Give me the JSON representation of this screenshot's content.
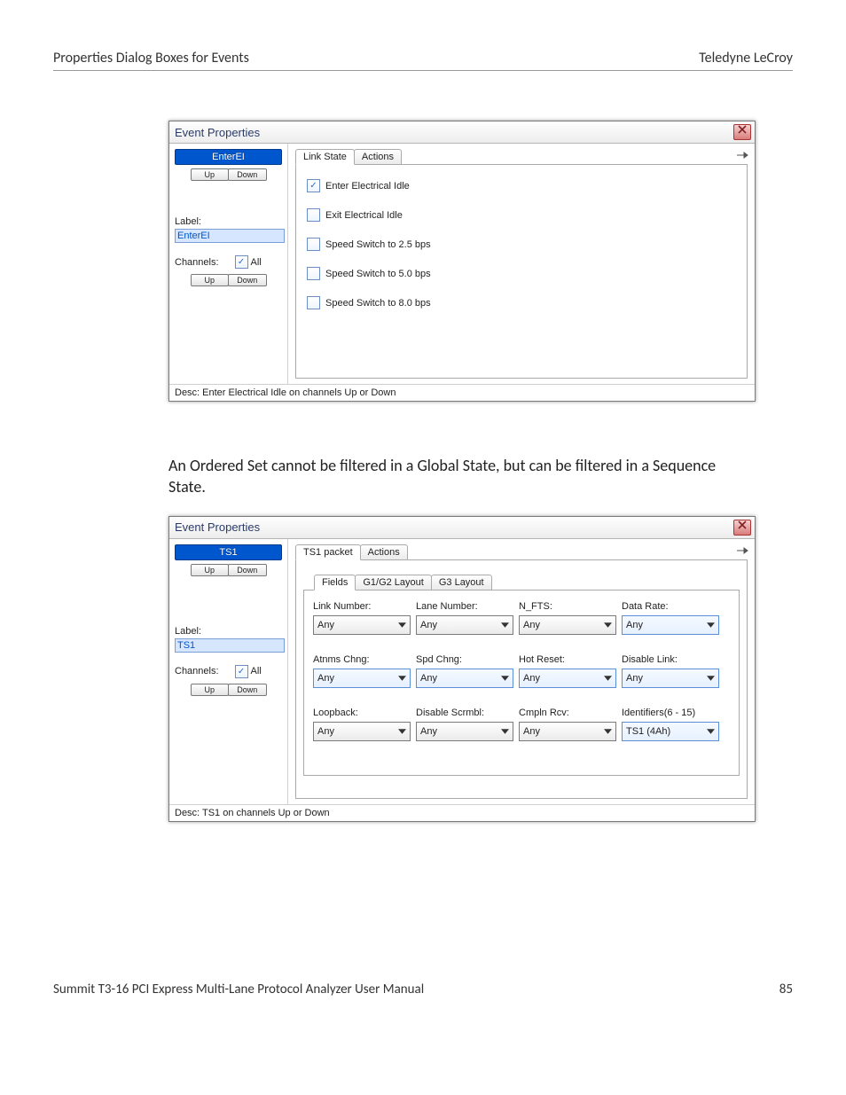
{
  "page": {
    "header_left": "Properties Dialog Boxes for Events",
    "header_right": "Teledyne LeCroy",
    "body_text": "An Ordered Set cannot be filtered in a Global State, but can be filtered in a Sequence State.",
    "footer_left": "Summit T3-16 PCI Express Multi-Lane Protocol Analyzer User Manual",
    "footer_right": "85"
  },
  "dialog1": {
    "title": "Event Properties",
    "pill": "EnterEI",
    "up": "Up",
    "down": "Down",
    "label_label": "Label:",
    "label_value": "EnterEI",
    "channels_label": "Channels:",
    "all_label": "All",
    "tabs": [
      "Link State",
      "Actions"
    ],
    "checks": [
      {
        "label": "Enter Electrical Idle",
        "checked": true
      },
      {
        "label": "Exit Electrical Idle",
        "checked": false
      },
      {
        "label": "Speed Switch to 2.5 bps",
        "checked": false
      },
      {
        "label": "Speed Switch to 5.0 bps",
        "checked": false
      },
      {
        "label": "Speed Switch to 8.0 bps",
        "checked": false
      }
    ],
    "desc": "Desc: Enter Electrical Idle on channels Up or Down"
  },
  "dialog2": {
    "title": "Event Properties",
    "pill": "TS1",
    "up": "Up",
    "down": "Down",
    "label_label": "Label:",
    "label_value": "TS1",
    "channels_label": "Channels:",
    "all_label": "All",
    "tabs": [
      "TS1 packet",
      "Actions"
    ],
    "subtabs": [
      "Fields",
      "G1/G2 Layout",
      "G3 Layout"
    ],
    "fields": {
      "r0": [
        {
          "label": "Link Number:",
          "value": "Any"
        },
        {
          "label": "Lane Number:",
          "value": "Any"
        },
        {
          "label": "N_FTS:",
          "value": "Any"
        },
        {
          "label": "Data Rate:",
          "value": "Any",
          "hl": true
        }
      ],
      "r1": [
        {
          "label": "Atnms Chng:",
          "value": "Any",
          "hl": true
        },
        {
          "label": "Spd Chng:",
          "value": "Any",
          "hl": true
        },
        {
          "label": "Hot Reset:",
          "value": "Any",
          "hl": true
        },
        {
          "label": "Disable Link:",
          "value": "Any",
          "hl": true
        }
      ],
      "r2": [
        {
          "label": "Loopback:",
          "value": "Any"
        },
        {
          "label": "Disable Scrmbl:",
          "value": "Any"
        },
        {
          "label": "Cmpln Rcv:",
          "value": "Any"
        },
        {
          "label": "Identifiers(6 - 15)",
          "value": "TS1 (4Ah)",
          "hl": true
        }
      ]
    },
    "desc": "Desc: TS1 on channels Up or Down"
  }
}
